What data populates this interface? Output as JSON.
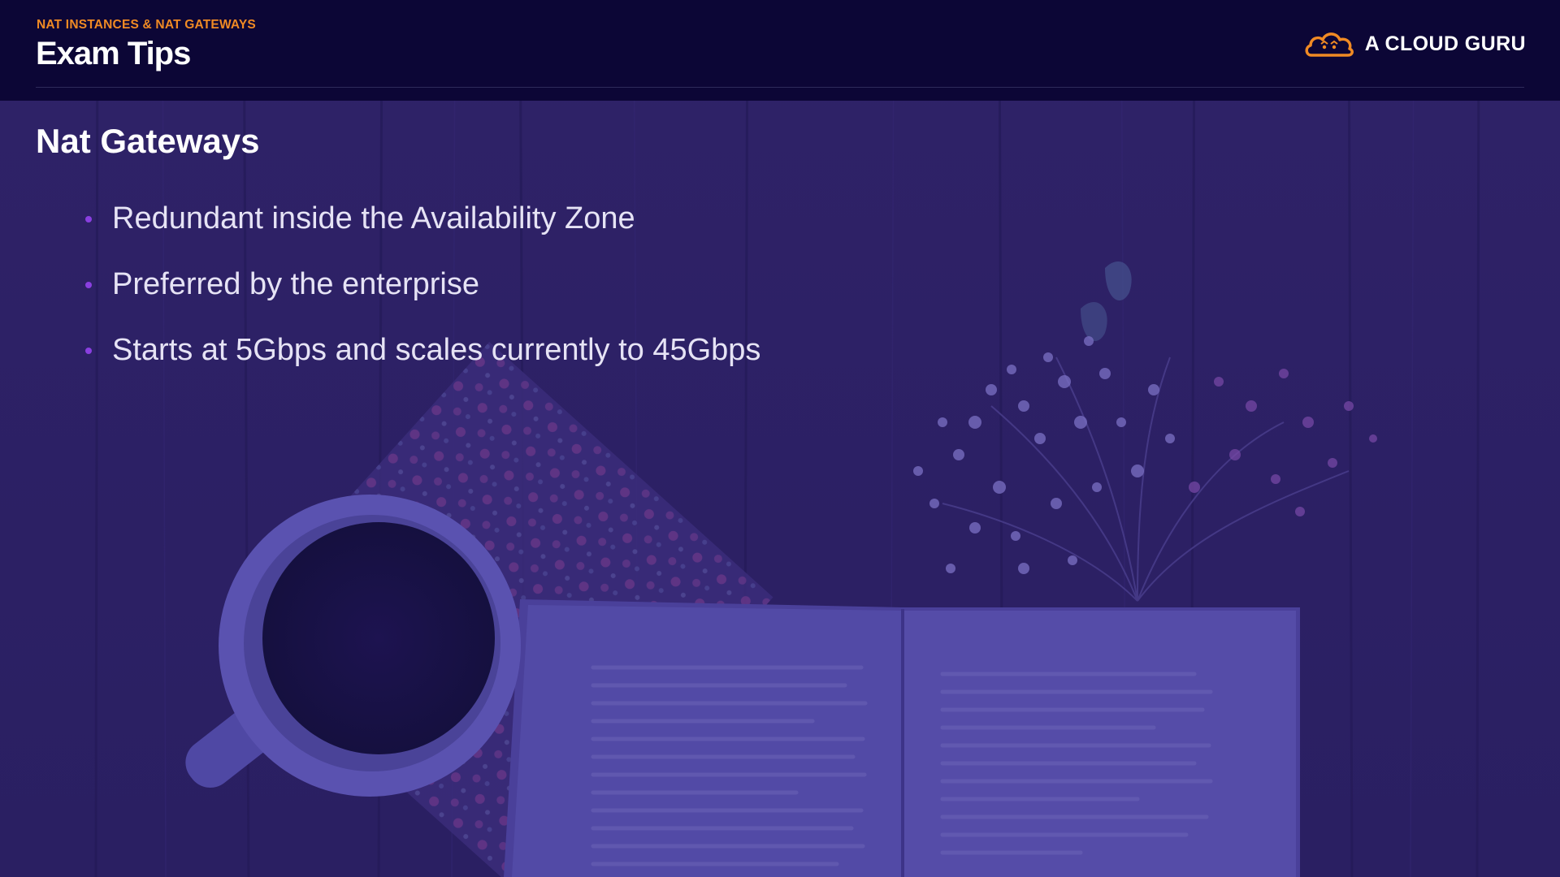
{
  "header": {
    "eyebrow": "NAT INSTANCES & NAT GATEWAYS",
    "title": "Exam Tips"
  },
  "brand": {
    "name": "A CLOUD GURU",
    "logo_icon": "cloud-icon",
    "accent_color": "#f08a24"
  },
  "content": {
    "heading": "Nat Gateways",
    "bullets": [
      {
        "text": "Redundant inside the Availability Zone"
      },
      {
        "text": "Preferred by the enterprise"
      },
      {
        "text": "Starts at 5Gbps and scales currently to 45Gbps"
      }
    ]
  },
  "colors": {
    "header_background": "#0c0636",
    "slide_background": "#2a1d66",
    "bullet_color": "#8a3fe0",
    "text_color": "#e6e3f5"
  }
}
